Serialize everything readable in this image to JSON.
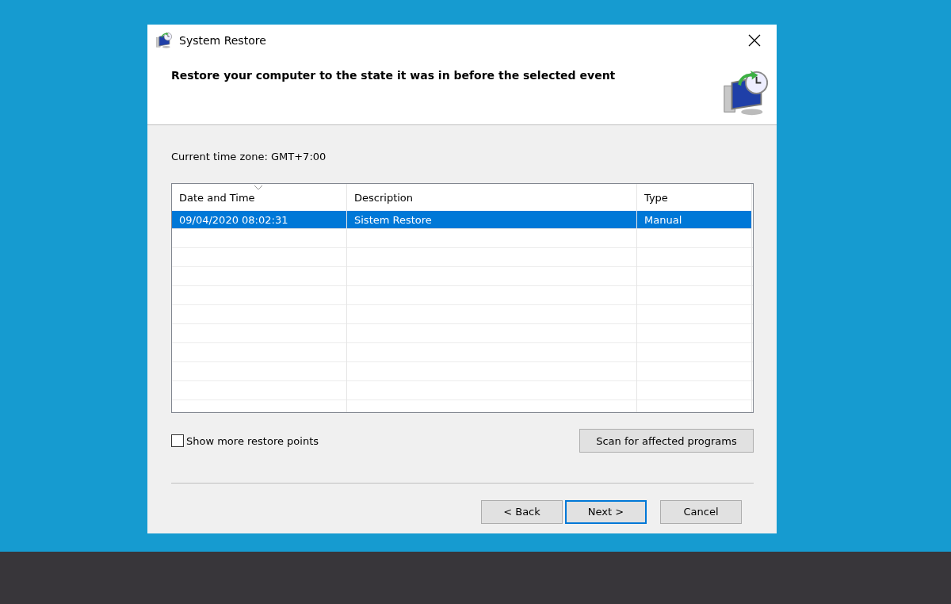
{
  "window": {
    "title": "System Restore"
  },
  "header": {
    "heading": "Restore your computer to the state it was in before the selected event"
  },
  "time_zone": "Current time zone: GMT+7:00",
  "table": {
    "columns": [
      {
        "label": "Date and Time",
        "sorted": true
      },
      {
        "label": "Description",
        "sorted": false
      },
      {
        "label": "Type",
        "sorted": false
      }
    ],
    "rows": [
      {
        "cells": [
          "09/04/2020 08:02:31",
          "Sistem Restore",
          "Manual"
        ],
        "selected": true
      }
    ]
  },
  "show_more": {
    "label": "Show more restore points",
    "checked": false
  },
  "scan_button": "Scan for affected programs",
  "buttons": [
    {
      "label": "< Back",
      "default": false
    },
    {
      "label": "Next >",
      "default": true
    },
    {
      "label": "Cancel",
      "default": false
    }
  ]
}
